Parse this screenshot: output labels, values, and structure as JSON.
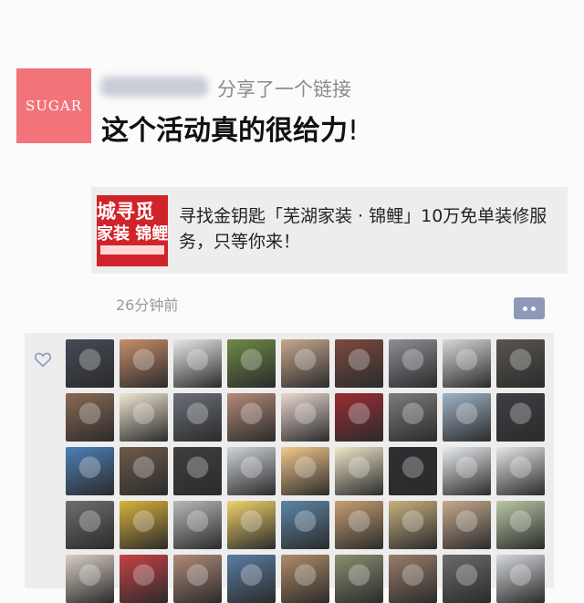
{
  "post": {
    "avatar_text": "SUGAR",
    "share_text": "分享了一个链接",
    "text": "这个活动真的很给力",
    "text_end": "!",
    "link": {
      "title": "寻找金钥匙「芜湖家装 · 锦鲤」10万免单装修服务，只等你来！",
      "thumb_line1": "城寻觅",
      "thumb_line2": "家装 锦鲤"
    },
    "time": "26分钟前"
  },
  "icons": {
    "comment": "comment-dots-icon",
    "like": "heart-outline-icon"
  },
  "colors": {
    "avatar_bg": "#f2737a",
    "comment_btn": "#8e99b7",
    "thumb_bg": "#d1232a",
    "likes_bg": "#ededed"
  },
  "likers_grid": {
    "rows": 5,
    "columns": 9,
    "cell_tones": [
      "#454b57",
      "#c98e6a",
      "#e9e9e9",
      "#6d8a46",
      "#c7a98e",
      "#7b4a3f",
      "#8c8f96",
      "#d8d8d8",
      "#5a5650",
      "#8a6a52",
      "#f0e6d2",
      "#6b6f7a",
      "#b58a7a",
      "#ead8cf",
      "#9b2c34",
      "#7c7c7c",
      "#9fb4c7",
      "#3d3f45",
      "#4d7fb8",
      "#6f5a49",
      "#3f3f3f",
      "#cfd4da",
      "#f4c98a",
      "#efe7c9",
      "#2f2f33",
      "#e9ecef",
      "#e6e6e6",
      "#6f6f6f",
      "#d9b23c",
      "#b8b8b8",
      "#f0d36b",
      "#5d86a8",
      "#c79e74",
      "#c8b07e",
      "#c7a98e",
      "#b9c8a5",
      "#d9cfc3",
      "#c84145",
      "#b08a78",
      "#5a7ca4",
      "#b28b6a",
      "#8a8f70",
      "#9a7d6a",
      "#6b6b6b",
      "#d5d8dc"
    ]
  }
}
